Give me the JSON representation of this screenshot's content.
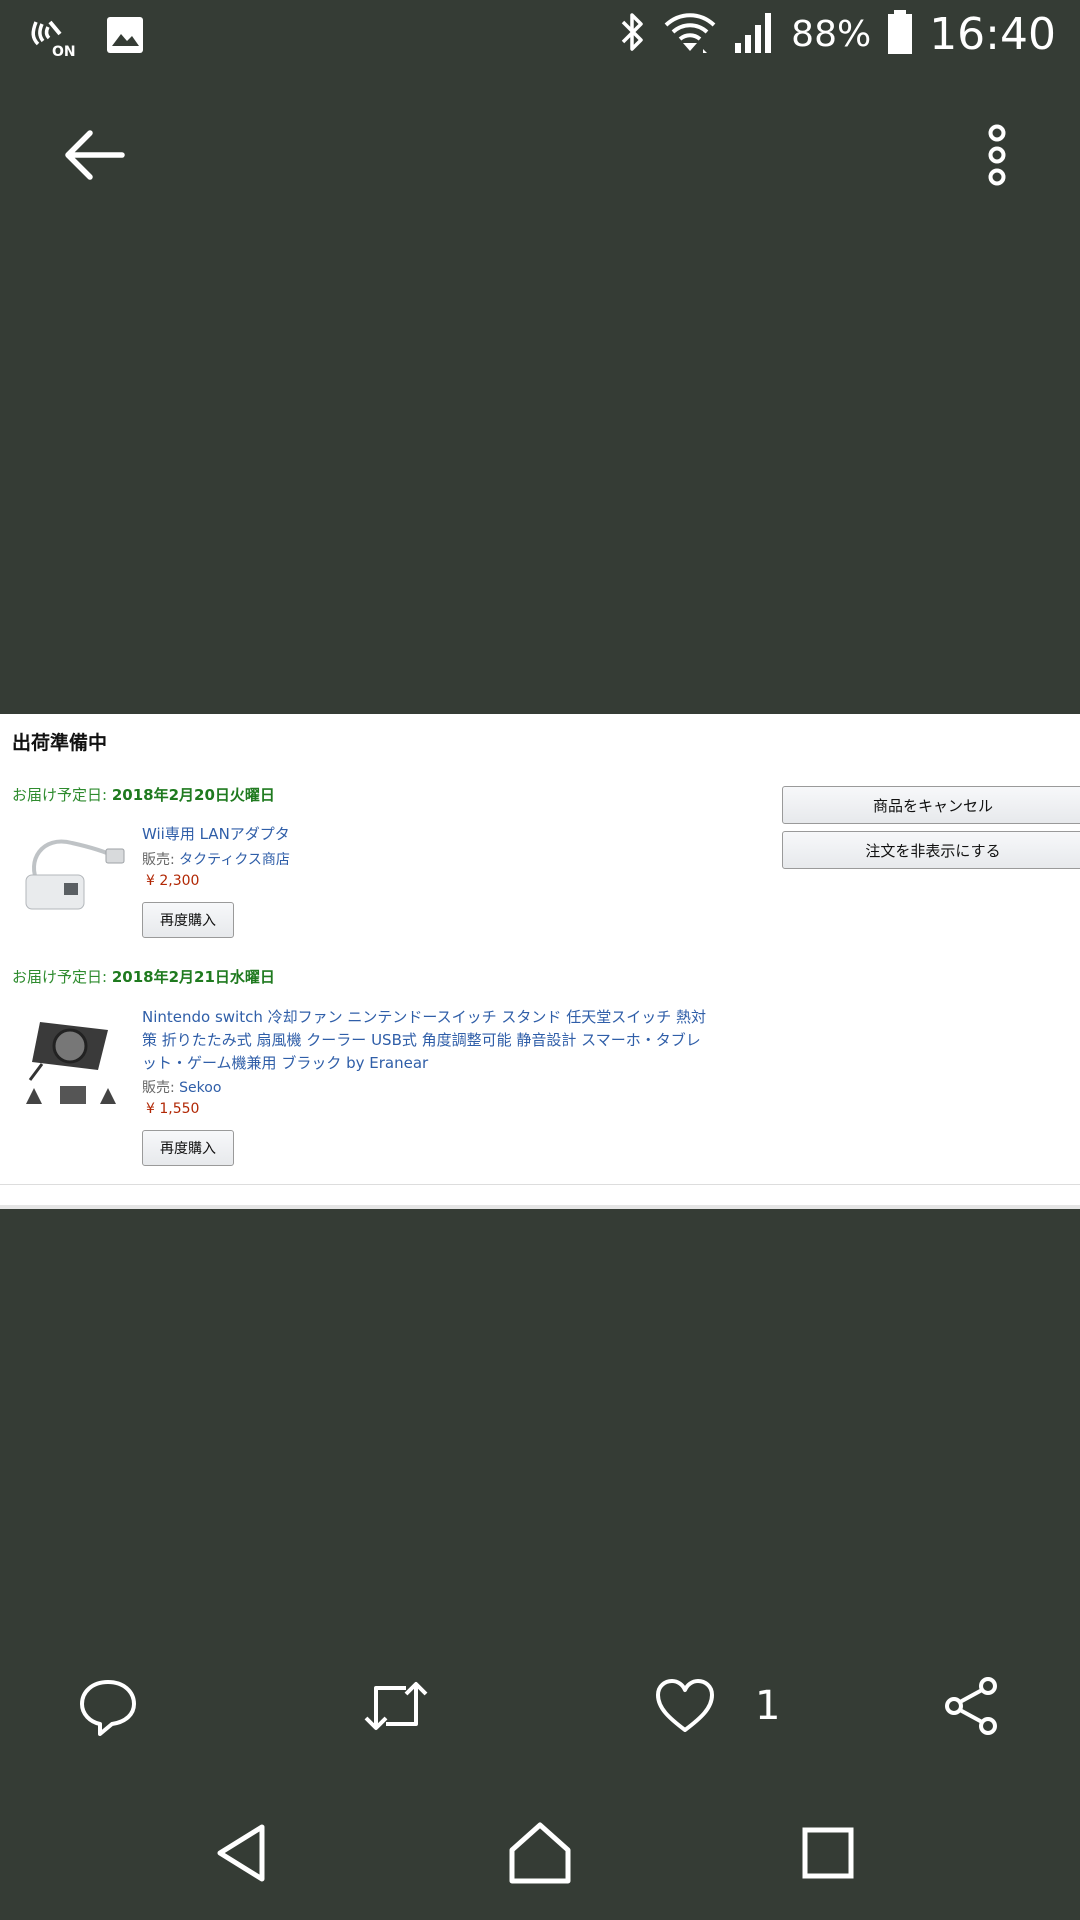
{
  "status_bar": {
    "battery": "88%",
    "time": "16:40",
    "icons": [
      "nfc-on-icon",
      "image-icon",
      "bluetooth-icon",
      "wifi-icon",
      "signal-icon",
      "battery-icon"
    ]
  },
  "app_bar": {
    "back_icon": "back-arrow-icon",
    "menu_icon": "more-vertical-icon"
  },
  "order": {
    "status": "出荷準備中",
    "cancel_label": "商品をキャンセル",
    "hide_label": "注文を非表示にする",
    "rebuy_label": "再度購入",
    "delivery_prefix": "お届け予定日:",
    "seller_prefix": "販売:",
    "items": [
      {
        "delivery_date": "2018年2月20日火曜日",
        "title": "Wii専用 LANアダプタ",
        "seller": "タクティクス商店",
        "price": "¥ 2,300"
      },
      {
        "delivery_date": "2018年2月21日水曜日",
        "title_lines": [
          "Nintendo switch 冷却ファン ニンテンドースイッチ スタンド 任天堂スイッチ 熱対",
          "策 折りたたみ式 扇風機 クーラー USB式 角度調整可能 静音設計 スマーホ・タブレ",
          "ット・ゲーム機兼用 ブラック by Eranear"
        ],
        "seller": "Sekoo",
        "price": "¥ 1,550"
      }
    ]
  },
  "actions": {
    "like_count": "1",
    "icons": [
      "reply-icon",
      "retweet-icon",
      "heart-icon",
      "share-icon"
    ]
  },
  "nav": {
    "icons": [
      "nav-back-icon",
      "nav-home-icon",
      "nav-recents-icon"
    ]
  }
}
